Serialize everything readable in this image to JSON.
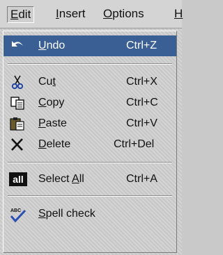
{
  "menubar": {
    "items": [
      {
        "label": "Edit"
      },
      {
        "label": "Insert"
      },
      {
        "label": "Options"
      },
      {
        "label": "H"
      }
    ]
  },
  "menu": {
    "undo": {
      "pre": "",
      "key": "U",
      "post": "ndo",
      "shortcut": "Ctrl+Z",
      "icon": "undo-arrow-icon"
    },
    "cut": {
      "pre": "Cu",
      "key": "t",
      "post": "",
      "shortcut": "Ctrl+X",
      "icon": "scissors-icon"
    },
    "copy": {
      "pre": "",
      "key": "C",
      "post": "opy",
      "shortcut": "Ctrl+C",
      "icon": "copy-pages-icon"
    },
    "paste": {
      "pre": "",
      "key": "P",
      "post": "aste",
      "shortcut": "Ctrl+V",
      "icon": "clipboard-icon"
    },
    "delete": {
      "pre": "",
      "key": "D",
      "post": "elete",
      "shortcut": "Ctrl+Del",
      "icon": "x-icon"
    },
    "select_all": {
      "pre": "Select ",
      "key": "A",
      "post": "ll",
      "shortcut": "Ctrl+A",
      "icon": "all-icon",
      "icon_text": "all"
    },
    "spell": {
      "pre": "",
      "key": "S",
      "post": "pell check",
      "shortcut": "",
      "icon": "spellcheck-icon",
      "icon_text": "ABC"
    }
  },
  "colors": {
    "highlight": "#3a5f94",
    "check": "#2a4fb0"
  }
}
